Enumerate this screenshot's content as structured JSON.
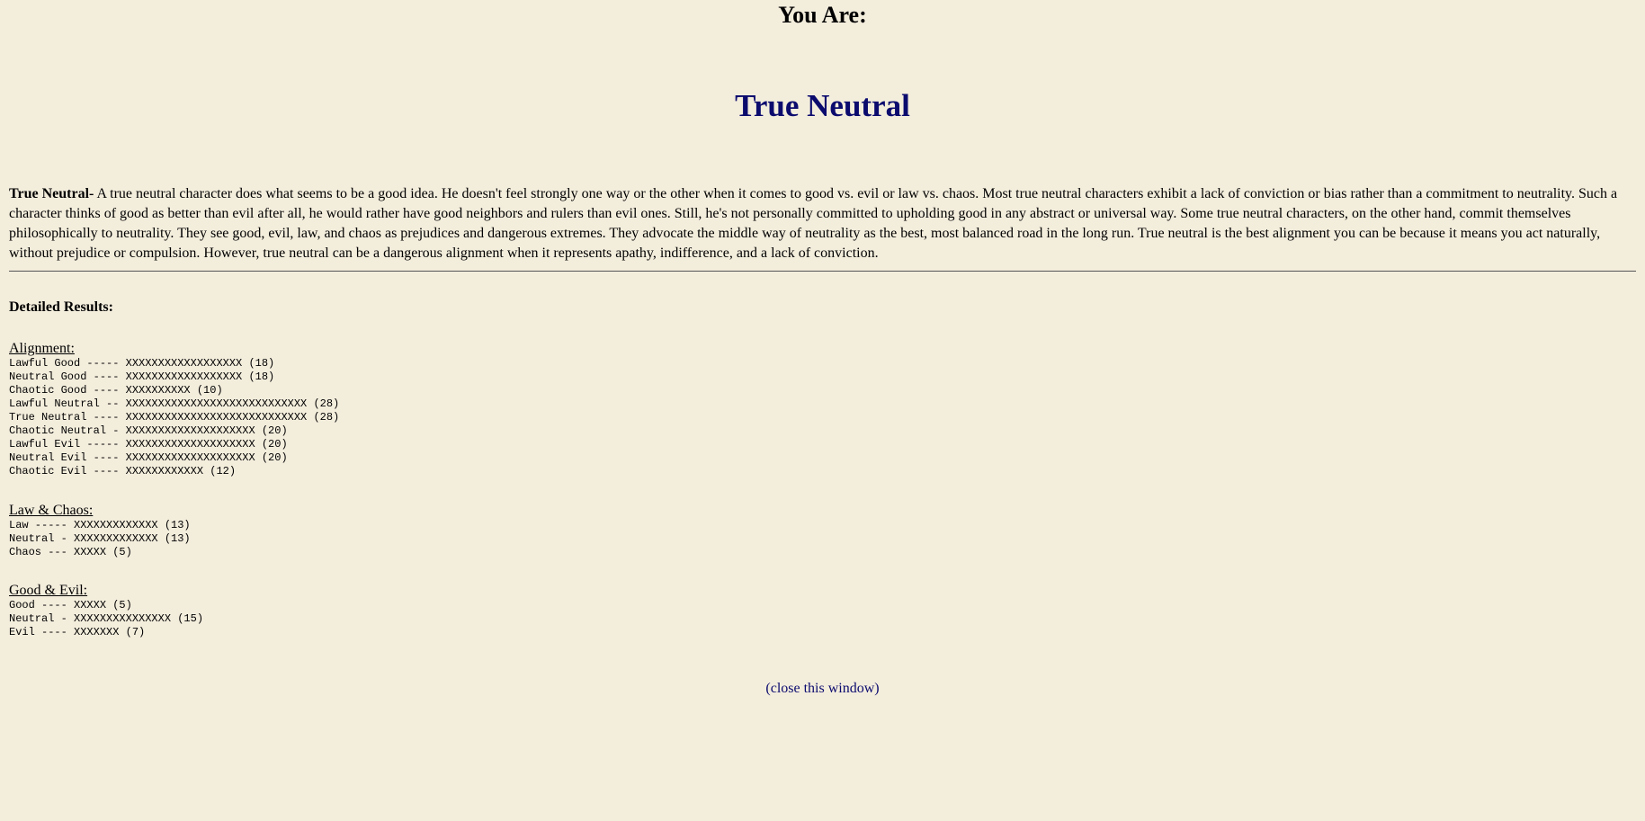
{
  "header": {
    "you_are": "You Are:",
    "result": "True Neutral"
  },
  "description": {
    "lead": "True Neutral-",
    "text": " A true neutral character does what seems to be a good idea. He doesn't feel strongly one way or the other when it comes to good vs. evil or law vs. chaos. Most true neutral characters exhibit a lack of conviction or bias rather than a commitment to neutrality. Such a character thinks of good as better than evil after all, he would rather have good neighbors and rulers than evil ones. Still, he's not personally committed to upholding good in any abstract or universal way. Some true neutral characters, on the other hand, commit themselves philosophically to neutrality. They see good, evil, law, and chaos as prejudices and dangerous extremes. They advocate the middle way of neutrality as the best, most balanced road in the long run. True neutral is the best alignment you can be because it means you act naturally, without prejudice or compulsion. However, true neutral can be a dangerous alignment when it represents apathy, indifference, and a lack of conviction."
  },
  "detailed_results": {
    "heading": "Detailed Results:",
    "alignment": {
      "title": "Alignment:",
      "lines": [
        "Lawful Good ----- XXXXXXXXXXXXXXXXXX (18)",
        "Neutral Good ---- XXXXXXXXXXXXXXXXXX (18)",
        "Chaotic Good ---- XXXXXXXXXX (10)",
        "Lawful Neutral -- XXXXXXXXXXXXXXXXXXXXXXXXXXXX (28)",
        "True Neutral ---- XXXXXXXXXXXXXXXXXXXXXXXXXXXX (28)",
        "Chaotic Neutral - XXXXXXXXXXXXXXXXXXXX (20)",
        "Lawful Evil ----- XXXXXXXXXXXXXXXXXXXX (20)",
        "Neutral Evil ---- XXXXXXXXXXXXXXXXXXXX (20)",
        "Chaotic Evil ---- XXXXXXXXXXXX (12)"
      ]
    },
    "law_chaos": {
      "title": "Law & Chaos:",
      "lines": [
        "Law ----- XXXXXXXXXXXXX (13)",
        "Neutral - XXXXXXXXXXXXX (13)",
        "Chaos --- XXXXX (5)"
      ]
    },
    "good_evil": {
      "title": "Good & Evil:",
      "lines": [
        "Good ---- XXXXX (5)",
        "Neutral - XXXXXXXXXXXXXXX (15)",
        "Evil ---- XXXXXXX (7)"
      ]
    }
  },
  "footer": {
    "close_link": "(close this window)"
  },
  "colors": {
    "background": "#f3eddc",
    "title": "#0b0b6e",
    "link": "#0b0b6e"
  }
}
